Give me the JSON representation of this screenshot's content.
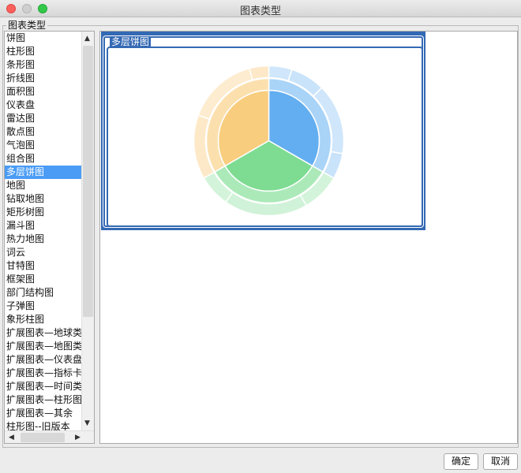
{
  "window": {
    "title": "图表类型"
  },
  "group": {
    "legend": "图表类型"
  },
  "chart_types": [
    "饼图",
    "柱形图",
    "条形图",
    "折线图",
    "面积图",
    "仪表盘",
    "雷达图",
    "散点图",
    "气泡图",
    "组合图",
    "多层饼图",
    "地图",
    "钻取地图",
    "矩形树图",
    "漏斗图",
    "热力地图",
    "词云",
    "甘特图",
    "框架图",
    "部门结构图",
    "子弹图",
    "象形柱图",
    "扩展图表—地球类",
    "扩展图表—地图类",
    "扩展图表—仪表盘",
    "扩展图表—指标卡",
    "扩展图表—时间类",
    "扩展图表—柱形图",
    "扩展图表—其余",
    "柱形图--旧版本"
  ],
  "selected_index": 10,
  "preview": {
    "title": "多层饼图"
  },
  "buttons": {
    "ok": "确定",
    "cancel": "取消"
  },
  "colors": {
    "accent": "#3469b4",
    "selection": "#4a9cf5",
    "blue": "#62aef0",
    "green": "#7ddc92",
    "orange": "#f8cd7e"
  },
  "icons": {
    "scroll_up": "▲",
    "scroll_down": "▼",
    "scroll_left": "◀",
    "scroll_right": "▶"
  }
}
